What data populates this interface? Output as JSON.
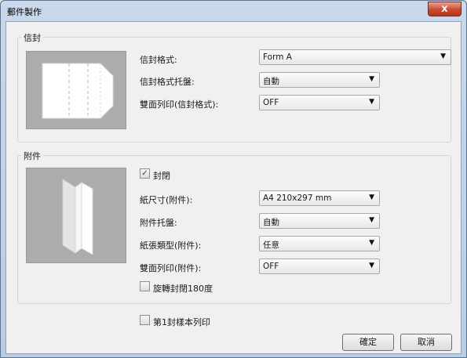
{
  "window": {
    "title": "郵件製作",
    "close_glyph": "x"
  },
  "envelope": {
    "group_title": "信封",
    "format_label": "信封格式:",
    "format_value": "Form A",
    "tray_label": "信封格式托盤:",
    "tray_value": "自動",
    "duplex_label": "雙面列印(信封格式):",
    "duplex_value": "OFF"
  },
  "attachment": {
    "group_title": "附件",
    "seal_label": "封閉",
    "seal_checked": true,
    "paper_size_label": "紙尺寸(附件):",
    "paper_size_value": "A4 210x297 mm",
    "tray_label": "附件托盤:",
    "tray_value": "自動",
    "paper_type_label": "紙張類型(附件):",
    "paper_type_value": "任意",
    "duplex_label": "雙面列印(附件):",
    "duplex_value": "OFF",
    "rotate_label": "旋轉封閉180度",
    "rotate_checked": false
  },
  "first_sample_label": "第1封樣本列印",
  "first_sample_checked": false,
  "buttons": {
    "ok": "確定",
    "cancel": "取消"
  },
  "icons": {
    "dropdown": "chevron-down-icon",
    "check": "checkmark-icon"
  }
}
